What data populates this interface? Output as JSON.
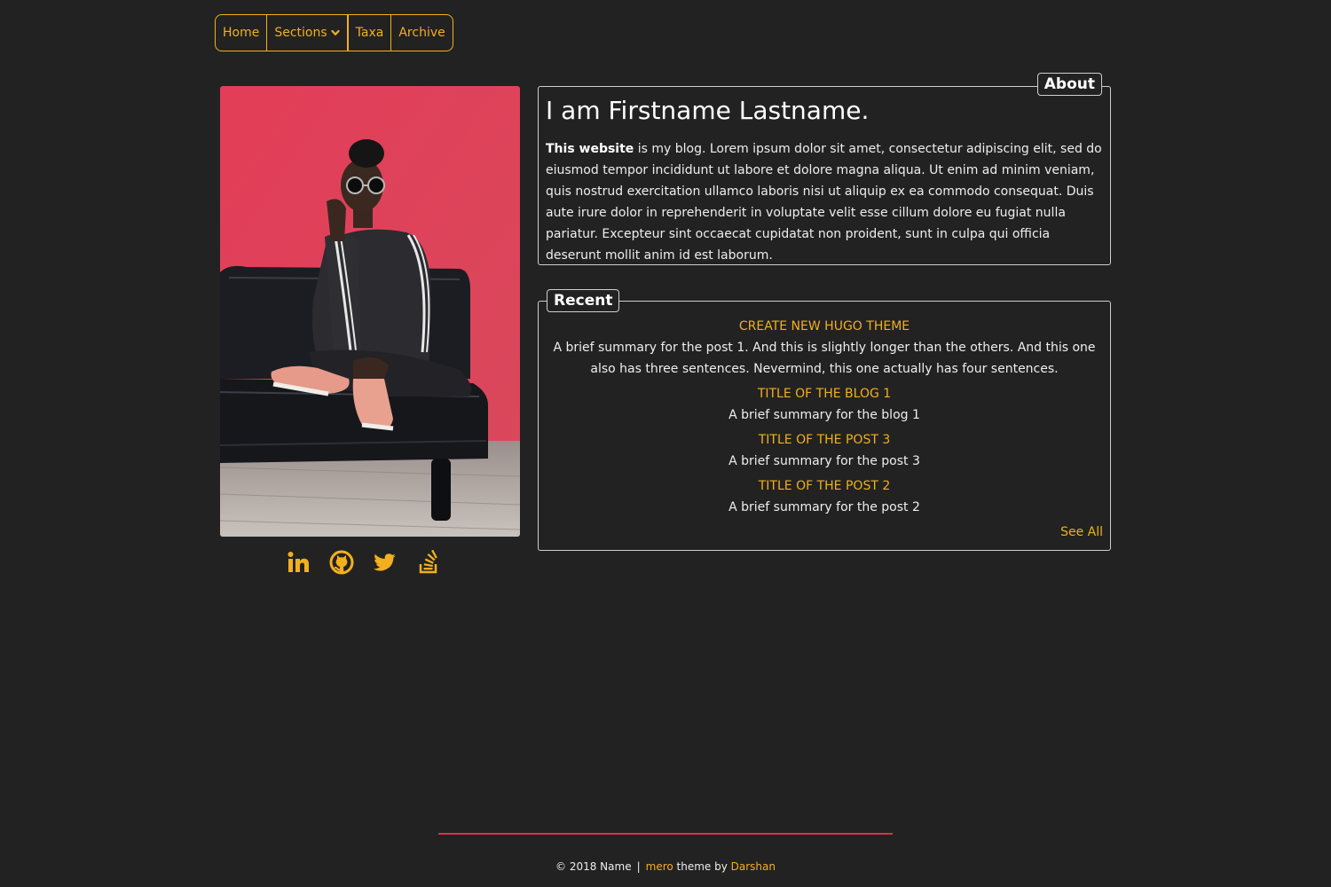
{
  "nav": {
    "items": [
      {
        "label": "Home"
      },
      {
        "label": "Sections"
      },
      {
        "label": "Taxa"
      },
      {
        "label": "Archive"
      }
    ]
  },
  "about": {
    "legend": "About",
    "heading": "I am Firstname Lastname.",
    "bold_intro": "This website",
    "text": " is my blog. Lorem ipsum dolor sit amet, consectetur adipiscing elit, sed do eiusmod tempor incididunt ut labore et dolore magna aliqua. Ut enim ad minim veniam, quis nostrud exercitation ullamco laboris nisi ut aliquip ex ea commodo consequat. Duis aute irure dolor in reprehenderit in voluptate velit esse cillum dolore eu fugiat nulla pariatur. Excepteur sint occaecat cupidatat non proident, sunt in culpa qui officia deserunt mollit anim id est laborum."
  },
  "recent": {
    "legend": "Recent",
    "posts": [
      {
        "title": "CREATE NEW HUGO THEME",
        "summary": "A brief summary for the post 1. And this is slightly longer than the others. And this one also has three sentences. Nevermind, this one actually has four sentences."
      },
      {
        "title": "TITLE OF THE BLOG 1",
        "summary": "A brief summary for the blog 1"
      },
      {
        "title": "TITLE OF THE POST 3",
        "summary": "A brief summary for the post 3"
      },
      {
        "title": "TITLE OF THE POST 2",
        "summary": "A brief summary for the post 2"
      }
    ],
    "see_all": "See All"
  },
  "social": [
    {
      "icon": "linkedin-icon"
    },
    {
      "icon": "github-icon"
    },
    {
      "icon": "twitter-icon"
    },
    {
      "icon": "stackoverflow-icon"
    }
  ],
  "footer": {
    "copyright": "© 2018 Name",
    "separator": "|",
    "theme_name": "mero",
    "theme_text": " theme by ",
    "author": "Darshan"
  },
  "colors": {
    "background": "#222222",
    "accent": "#f2b01e",
    "footer_line": "#d9304a"
  }
}
